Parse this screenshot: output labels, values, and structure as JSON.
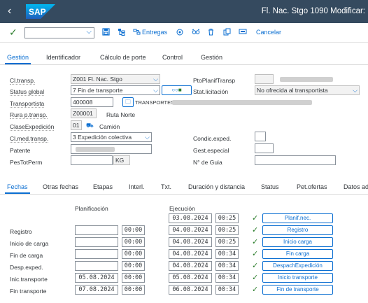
{
  "header": {
    "logo_text": "SAP",
    "title": "Fl. Nac. Stgo 1090 Modificar:"
  },
  "toolbar": {
    "entregas_label": "Entregas",
    "cancelar_label": "Cancelar"
  },
  "tabs_top": [
    "Gestión",
    "Identificador",
    "Cálculo de porte",
    "Control",
    "Gestión"
  ],
  "form": {
    "cltransp": {
      "label": "Cl.transp.",
      "value": "Z001 Fl. Nac. Stgo"
    },
    "ptoplanif": {
      "label": "PtoPlanifTransp"
    },
    "status_global": {
      "label": "Status global",
      "value": "7 Fin de transporte"
    },
    "stat_licitacion": {
      "label": "Stat.licitación",
      "value": "No ofrecida al transportista"
    },
    "transportista": {
      "label": "Transportista",
      "value": "400008",
      "suffix": "TRANSPORTES"
    },
    "rura": {
      "label": "Rura p.transp.",
      "value": "Z00001",
      "desc": "Ruta Norte"
    },
    "clase_exped": {
      "label": "ClaseExpedición",
      "value": "01",
      "desc": "Camión"
    },
    "clmed": {
      "label": "Cl.med.transp.",
      "value": "3 Expedición colectiva"
    },
    "condic": {
      "label": "Condic.exped."
    },
    "patente": {
      "label": "Patente"
    },
    "gest_especial": {
      "label": "Gest.especial"
    },
    "pestotperm": {
      "label": "PesTotPerm",
      "unit": "KG"
    },
    "num_guia": {
      "label": "N° de Guia"
    }
  },
  "tabs_bottom": [
    "Fechas",
    "Otras fechas",
    "Etapas",
    "Interl.",
    "Txt.",
    "Duración y distancia",
    "Status",
    "Pet.ofertas",
    "Datos ad"
  ],
  "dates": {
    "planificacion_header": "Planificación",
    "ejecucion_header": "Ejecución",
    "planif_row": {
      "exec_date": "03.08.2024",
      "exec_time": "00:25",
      "button": "Planif.nec."
    },
    "rows": [
      {
        "label": "Registro",
        "plan_date": "",
        "plan_time": "00:00",
        "exec_date": "04.08.2024",
        "exec_time": "00:25",
        "button": "Registro"
      },
      {
        "label": "Inicio de carga",
        "plan_date": "",
        "plan_time": "00:00",
        "exec_date": "04.08.2024",
        "exec_time": "00:25",
        "button": "Inicio carga"
      },
      {
        "label": "Fin de carga",
        "plan_date": "",
        "plan_time": "00:00",
        "exec_date": "04.08.2024",
        "exec_time": "00:34",
        "button": "Fin carga"
      },
      {
        "label": "Desp.exped.",
        "plan_date": "",
        "plan_time": "00:00",
        "exec_date": "04.08.2024",
        "exec_time": "00:34",
        "button": "DespachExpedición"
      },
      {
        "label": "Inic.transporte",
        "plan_date": "05.08.2024",
        "plan_time": "00:00",
        "exec_date": "05.08.2024",
        "exec_time": "00:34",
        "button": "Inicio transporte"
      },
      {
        "label": "Fin transporte",
        "plan_date": "07.08.2024",
        "plan_time": "00:00",
        "exec_date": "06.08.2024",
        "exec_time": "00:34",
        "button": "Fin de transporte"
      }
    ]
  },
  "colors": {
    "shell": "#354a5f",
    "accent": "#0a6ed1",
    "ok": "#2b7d2b"
  }
}
